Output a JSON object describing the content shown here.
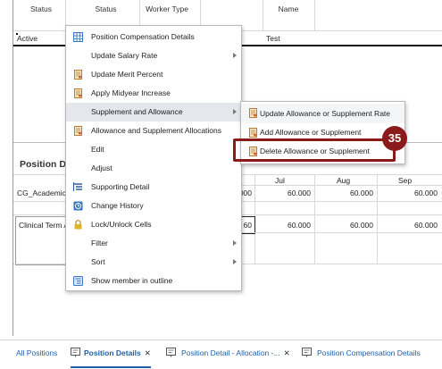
{
  "table": {
    "headers": {
      "status": "Status",
      "status2": "Status",
      "worker_type": "Worker Type",
      "name": "Name"
    },
    "row_status": "Active",
    "row_name": "Test"
  },
  "section": {
    "title": "Position D",
    "months": [
      "Jul",
      "Aug",
      "Sep"
    ],
    "rows": [
      {
        "label": "CG_Academic",
        "partial": "000",
        "values": [
          "60.000",
          "60.000",
          "60.000"
        ]
      },
      {
        "label": "Clinical Term A",
        "partial": "60",
        "values": [
          "60.000",
          "60.000",
          "60.000"
        ]
      }
    ]
  },
  "context_menu": {
    "items": [
      {
        "label": "Position Compensation Details",
        "icon": "grid-icon",
        "submenu": false
      },
      {
        "label": "Update Salary Rate",
        "icon": "",
        "submenu": true
      },
      {
        "label": "Update Merit Percent",
        "icon": "form-icon",
        "submenu": false
      },
      {
        "label": "Apply Midyear Increase",
        "icon": "form-icon",
        "submenu": false
      },
      {
        "label": "Supplement and Allowance",
        "icon": "",
        "submenu": true
      },
      {
        "label": "Allowance and Supplement Allocations",
        "icon": "form-icon",
        "submenu": false
      },
      {
        "label": "Edit",
        "icon": "",
        "submenu": false
      },
      {
        "label": "Adjust",
        "icon": "",
        "submenu": false
      },
      {
        "label": "Supporting Detail",
        "icon": "supporting-detail-icon",
        "submenu": false
      },
      {
        "label": "Change History",
        "icon": "change-history-icon",
        "submenu": false
      },
      {
        "label": "Lock/Unlock Cells",
        "icon": "lock-icon",
        "submenu": false
      },
      {
        "label": "Filter",
        "icon": "",
        "submenu": true
      },
      {
        "label": "Sort",
        "icon": "",
        "submenu": true
      },
      {
        "label": "Show member in outline",
        "icon": "outline-icon",
        "submenu": false
      }
    ]
  },
  "submenu": {
    "items": [
      {
        "label": "Update Allowance or Supplement Rate",
        "icon": "form-icon"
      },
      {
        "label": "Add Allowance or Supplement",
        "icon": "form-icon"
      },
      {
        "label": "Delete Allowance or Supplement",
        "icon": "form-icon"
      }
    ]
  },
  "step_badge": "35",
  "colors": {
    "accent_red": "#8b1a1a",
    "link_blue": "#1f5fa8",
    "selected_bg": "#e4e7ec"
  },
  "tabs": [
    {
      "label": "All Positions",
      "icon": "",
      "close": false
    },
    {
      "label": "Position Details",
      "icon": "form-icon",
      "close": true
    },
    {
      "label": "Position Detail - Allocation -...",
      "icon": "form-icon",
      "close": true
    },
    {
      "label": "Position Compensation Details",
      "icon": "form-icon",
      "close": false
    }
  ]
}
